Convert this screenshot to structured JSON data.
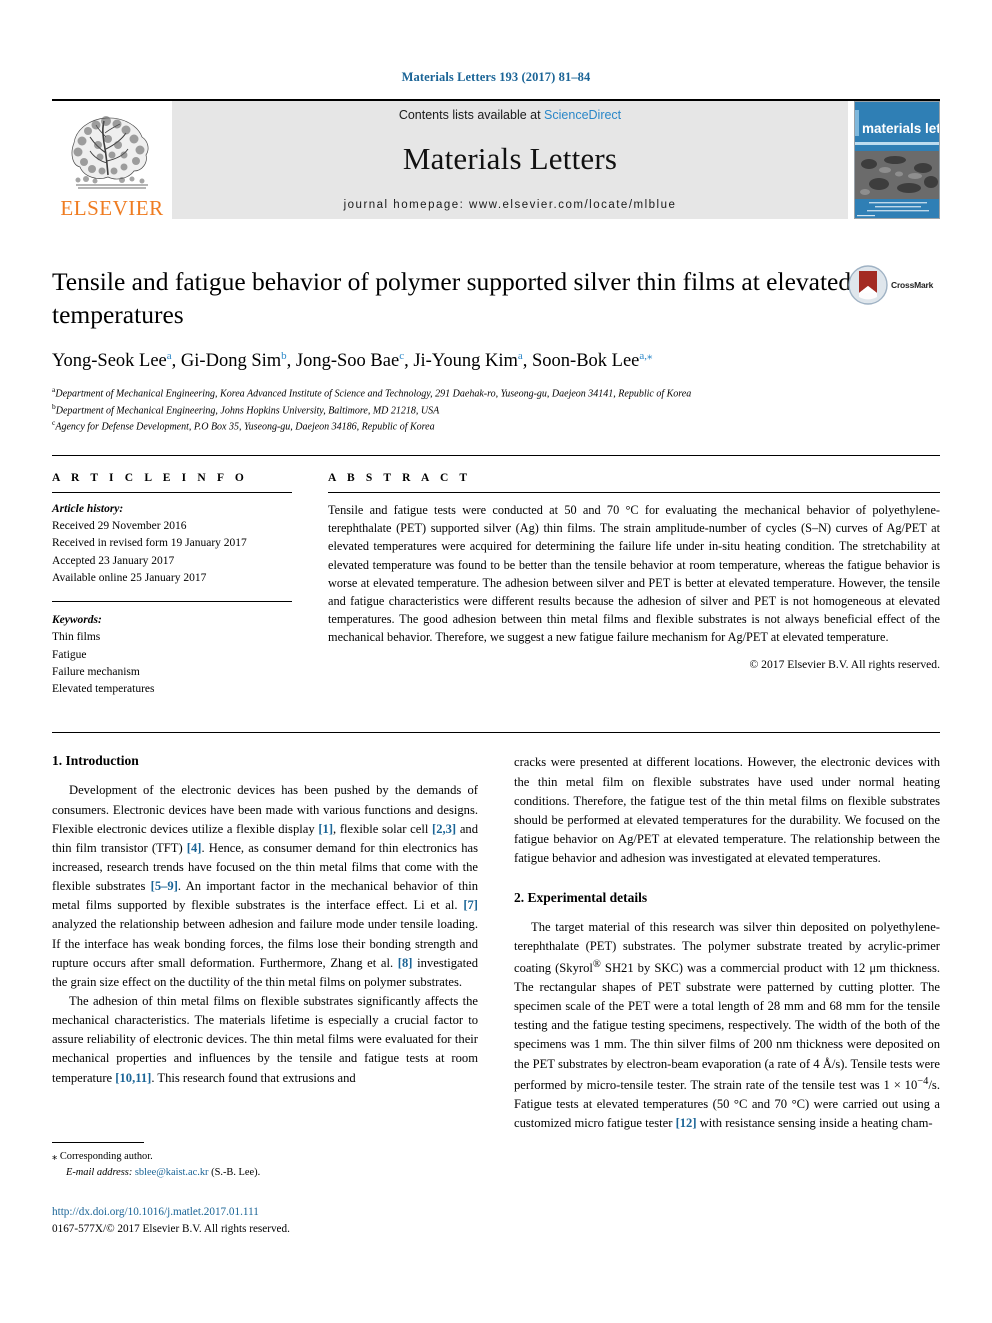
{
  "running_head": "Materials Letters 193 (2017) 81–84",
  "masthead": {
    "publisher_name": "ELSEVIER",
    "contents_prefix": "Contents lists available at ",
    "contents_link": "ScienceDirect",
    "journal_name": "Materials Letters",
    "homepage": "journal homepage: www.elsevier.com/locate/mlblue",
    "cover_title": "materials letters"
  },
  "article": {
    "title": "Tensile and fatigue behavior of polymer supported silver thin films at elevated temperatures",
    "crossmark_label": "CrossMark",
    "authors": [
      {
        "name": "Yong-Seok Lee",
        "marks": "a",
        "sep": ", "
      },
      {
        "name": "Gi-Dong Sim",
        "marks": "b",
        "sep": ", "
      },
      {
        "name": "Jong-Soo Bae",
        "marks": "c",
        "sep": ", "
      },
      {
        "name": "Ji-Young Kim",
        "marks": "a",
        "sep": ", "
      },
      {
        "name": "Soon-Bok Lee",
        "marks": "a,⁎",
        "sep": ""
      }
    ],
    "affiliations": [
      {
        "mark": "a",
        "text": "Department of Mechanical Engineering, Korea Advanced Institute of Science and Technology, 291 Daehak-ro, Yuseong-gu, Daejeon 34141, Republic of Korea"
      },
      {
        "mark": "b",
        "text": "Department of Mechanical Engineering, Johns Hopkins University, Baltimore, MD 21218, USA"
      },
      {
        "mark": "c",
        "text": "Agency for Defense Development, P.O Box 35, Yuseong-gu, Daejeon 34186, Republic of Korea"
      }
    ]
  },
  "article_info": {
    "heading": "A R T I C L E   I N F O",
    "history_label": "Article history:",
    "history": [
      "Received 29 November 2016",
      "Received in revised form 19 January 2017",
      "Accepted 23 January 2017",
      "Available online 25 January 2017"
    ],
    "keywords_label": "Keywords:",
    "keywords": [
      "Thin films",
      "Fatigue",
      "Failure mechanism",
      "Elevated temperatures"
    ]
  },
  "abstract": {
    "heading": "A B S T R A C T",
    "text": "Tensile and fatigue tests were conducted at 50 and 70 °C for evaluating the mechanical behavior of polyethylene-terephthalate (PET) supported silver (Ag) thin films. The strain amplitude-number of cycles (S–N) curves of Ag/PET at elevated temperatures were acquired for determining the failure life under in-situ heating condition. The stretchability at elevated temperature was found to be better than the tensile behavior at room temperature, whereas the fatigue behavior is worse at elevated temperature. The adhesion between silver and PET is better at elevated temperature. However, the tensile and fatigue characteristics were different results because the adhesion of silver and PET is not homogeneous at elevated temperatures. The good adhesion between thin metal films and flexible substrates is not always beneficial effect of the mechanical behavior. Therefore, we suggest a new fatigue failure mechanism for Ag/PET at elevated temperature.",
    "copyright": "© 2017 Elsevier B.V. All rights reserved."
  },
  "sections": {
    "introduction_heading": "1. Introduction",
    "intro_p1_a": "Development of the electronic devices has been pushed by the demands of consumers. Electronic devices have been made with various functions and designs. Flexible electronic devices utilize a flexible display ",
    "intro_ref_1": "[1]",
    "intro_p1_b": ", flexible solar cell ",
    "intro_ref_23": "[2,3]",
    "intro_p1_c": " and thin film transistor (TFT) ",
    "intro_ref_4": "[4]",
    "intro_p1_d": ". Hence, as consumer demand for thin electronics has increased, research trends have focused on the thin metal films that come with the flexible substrates ",
    "intro_ref_59": "[5–9]",
    "intro_p1_e": ". An important factor in the mechanical behavior of thin metal films supported by flexible substrates is the interface effect. Li et al. ",
    "intro_ref_7": "[7]",
    "intro_p1_f": " analyzed the relationship between adhesion and failure mode under tensile loading. If the interface has weak bonding forces, the films lose their bonding strength and rupture occurs after small deformation. Furthermore, Zhang et al. ",
    "intro_ref_8": "[8]",
    "intro_p1_g": " investigated the grain size effect on the ductility of the thin metal films on polymer substrates.",
    "intro_p2_a": "The adhesion of thin metal films on flexible substrates significantly affects the mechanical characteristics. The materials lifetime is especially a crucial factor to assure reliability of electronic devices. The thin metal films were evaluated for their mechanical properties and influences by the tensile and fatigue tests at room temperature ",
    "intro_ref_1011": "[10,11]",
    "intro_p2_b": ". This research found that extrusions and",
    "intro_p3": "cracks were presented at different locations. However, the electronic devices with the thin metal film on flexible substrates have used under normal heating conditions. Therefore, the fatigue test of the thin metal films on flexible substrates should be performed at elevated temperatures for the durability. We focused on the fatigue behavior on Ag/PET at elevated temperature. The relationship between the fatigue behavior and adhesion was investigated at elevated temperatures.",
    "experimental_heading": "2. Experimental details",
    "exp_p1_a": "The target material of this research was silver thin deposited on polyethylene-terephthalate (PET) substrates. The polymer substrate treated by acrylic-primer coating (Skyrol",
    "exp_p1_reg": "®",
    "exp_p1_b": " SH21 by SKC) was a commercial product with 12 μm thickness. The rectangular shapes of PET substrate were patterned by cutting plotter. The specimen scale of the PET were a total length of 28 mm and 68 mm for the tensile testing and the fatigue testing specimens, respectively. The width of the both of the specimens was 1 mm. The thin silver films of 200 nm thickness were deposited on the PET substrates by electron-beam evaporation (a rate of 4 Å/s). Tensile tests were performed by micro-tensile tester. The strain rate of the tensile test was 1 × 10",
    "exp_p1_exp": "−4",
    "exp_p1_c": "/s. Fatigue tests at elevated temperatures (50 °C and 70 °C) were carried out using a customized micro fatigue tester ",
    "exp_ref_12": "[12]",
    "exp_p1_d": " with resistance sensing inside a heating cham-"
  },
  "footnote": {
    "corresponding_mark": "⁎",
    "corresponding_text": "Corresponding author.",
    "email_label": "E-mail address:",
    "email": "sblee@kaist.ac.kr",
    "email_suffix": "(S.-B. Lee).",
    "doi": "http://dx.doi.org/10.1016/j.matlet.2017.01.111",
    "issn_line": "0167-577X/© 2017 Elsevier B.V. All rights reserved."
  },
  "colors": {
    "link": "#1a6496",
    "science_direct": "#2a87c8",
    "elsevier_orange": "#ef7c21",
    "cover_blue": "#2f7fb5",
    "masthead_gray": "#e6e6e6"
  }
}
